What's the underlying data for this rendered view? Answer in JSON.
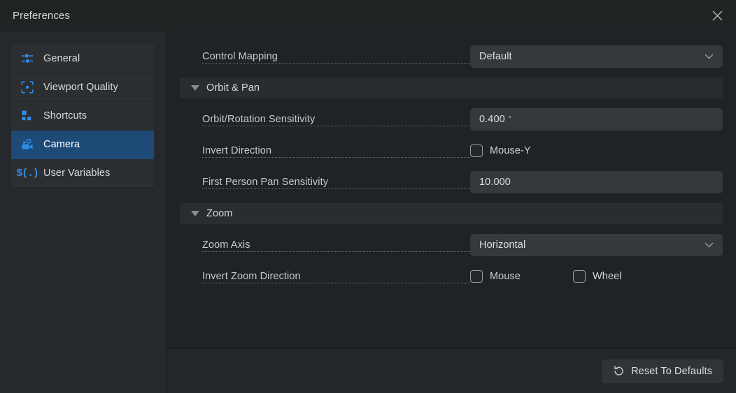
{
  "window": {
    "title": "Preferences",
    "close_icon": "close-icon"
  },
  "sidebar": {
    "items": [
      {
        "label": "General",
        "icon": "sliders-icon",
        "selected": false
      },
      {
        "label": "Viewport Quality",
        "icon": "viewport-icon",
        "selected": false
      },
      {
        "label": "Shortcuts",
        "icon": "grid-icon",
        "selected": false
      },
      {
        "label": "Camera",
        "icon": "camera-icon",
        "selected": true
      },
      {
        "label": "User Variables",
        "icon": "variable-icon",
        "selected": false,
        "glyph": "$(.)"
      }
    ]
  },
  "content": {
    "control_mapping": {
      "label": "Control Mapping",
      "value": "Default",
      "type": "dropdown"
    },
    "orbit_pan": {
      "title": "Orbit & Pan",
      "expanded": true,
      "orbit_sensitivity": {
        "label": "Orbit/Rotation Sensitivity",
        "value": "0.400",
        "suffix": "°",
        "type": "number"
      },
      "invert_direction": {
        "label": "Invert Direction",
        "checkboxes": [
          {
            "label": "Mouse-Y",
            "checked": false
          }
        ]
      },
      "pan_sensitivity": {
        "label": "First Person Pan Sensitivity",
        "value": "10.000",
        "suffix": "",
        "type": "number"
      }
    },
    "zoom": {
      "title": "Zoom",
      "expanded": true,
      "zoom_axis": {
        "label": "Zoom Axis",
        "value": "Horizontal",
        "type": "dropdown"
      },
      "invert_zoom": {
        "label": "Invert Zoom Direction",
        "checkboxes": [
          {
            "label": "Mouse",
            "checked": false
          },
          {
            "label": "Wheel",
            "checked": false
          }
        ]
      }
    }
  },
  "footer": {
    "reset_label": "Reset To Defaults",
    "reset_icon": "undo-arrow-icon"
  },
  "colors": {
    "accent_blue": "#2f8fe8",
    "selected_row": "#1d4a77",
    "window_bg": "#202325",
    "sidebar_bg": "#26292b",
    "field_bg": "#36393b"
  }
}
